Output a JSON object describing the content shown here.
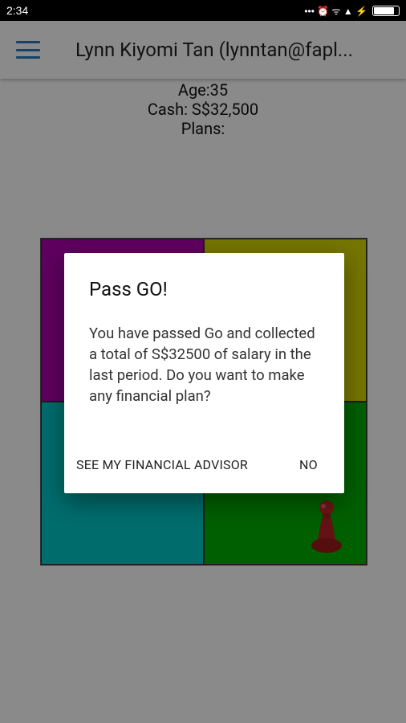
{
  "status_bar": {
    "time": "2:34",
    "indicators": "••• ⏰ ᯤ ▲ ⚡",
    "battery_level": 0.78
  },
  "app_bar": {
    "title": "Lynn Kiyomi Tan (lynntan@fapl...",
    "menu_icon": "hamburger-menu-icon",
    "accent_color": "#2b7bbf"
  },
  "player_info": {
    "age": "Age:35",
    "cash": "Cash: S$32,500",
    "plans": "Plans:"
  },
  "board": {
    "quadrant_colors": [
      "#b000b0",
      "#d8d800",
      "#00c8c8",
      "#00b000"
    ],
    "token_icon": "game-pawn-icon",
    "token_color": "#b22222"
  },
  "dialog": {
    "title": "Pass GO!",
    "message": "You have passed Go and collected a total of S$32500 of salary in the last period. Do you want to make any financial plan?",
    "advisor_button": "SEE MY FINANCIAL ADVISOR",
    "no_button": "NO"
  }
}
